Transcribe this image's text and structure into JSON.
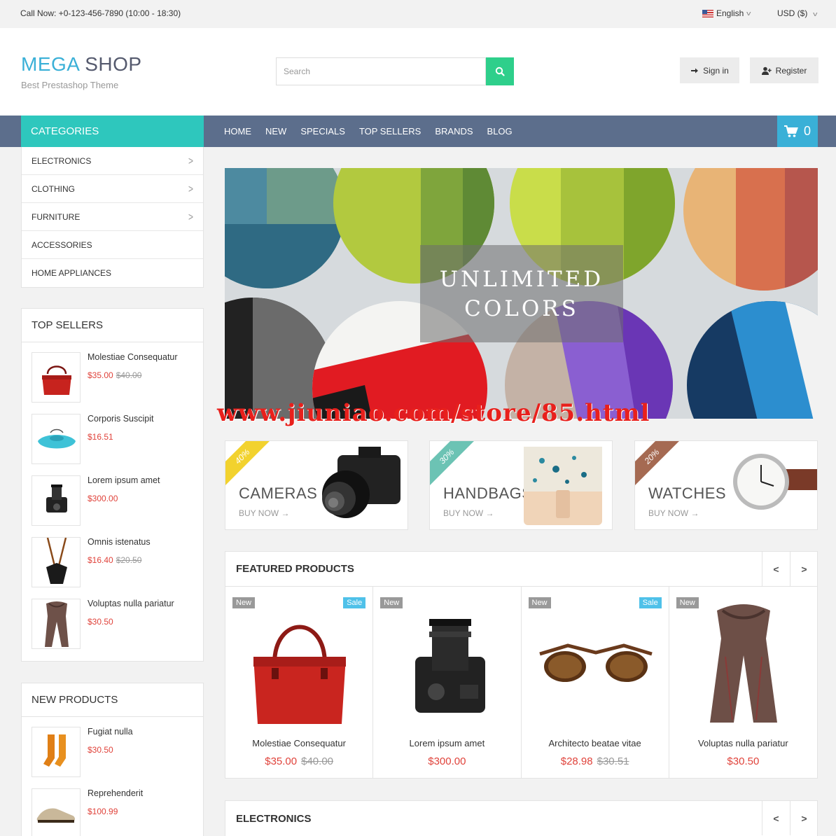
{
  "topbar": {
    "call": "Call Now: +0-123-456-7890 (10:00 - 18:30)",
    "language": "English",
    "currency": "USD ($)"
  },
  "header": {
    "logo_part1": "MEGA",
    "logo_part2": "SHOP",
    "tagline": "Best Prestashop Theme",
    "search_placeholder": "Search",
    "signin": "Sign in",
    "register": "Register"
  },
  "nav": {
    "categories_title": "CATEGORIES",
    "items": [
      "HOME",
      "NEW",
      "SPECIALS",
      "TOP SELLERS",
      "BRANDS",
      "BLOG"
    ],
    "cart_count": "0"
  },
  "categories": [
    {
      "label": "ELECTRONICS",
      "has_sub": true
    },
    {
      "label": "CLOTHING",
      "has_sub": true
    },
    {
      "label": "FURNITURE",
      "has_sub": true
    },
    {
      "label": "ACCESSORIES",
      "has_sub": false
    },
    {
      "label": "HOME APPLIANCES",
      "has_sub": false
    }
  ],
  "top_sellers": {
    "title": "TOP SELLERS",
    "items": [
      {
        "name": "Molestiae Consequatur",
        "price": "$35.00",
        "old_price": "$40.00",
        "icon": "handbag-icon"
      },
      {
        "name": "Corporis Suscipit",
        "price": "$16.51",
        "old_price": "",
        "icon": "clutch-icon"
      },
      {
        "name": "Lorem ipsum amet",
        "price": "$300.00",
        "old_price": "",
        "icon": "camera-icon"
      },
      {
        "name": "Omnis istenatus",
        "price": "$16.40",
        "old_price": "$20.50",
        "icon": "necklace-icon"
      },
      {
        "name": "Voluptas nulla pariatur",
        "price": "$30.50",
        "old_price": "",
        "icon": "scarf-icon"
      }
    ]
  },
  "new_products": {
    "title": "NEW PRODUCTS",
    "items": [
      {
        "name": "Fugiat nulla",
        "price": "$30.50",
        "icon": "socks-icon"
      },
      {
        "name": "Reprehenderit",
        "price": "$100.99",
        "icon": "shoe-icon"
      }
    ]
  },
  "banner": {
    "line1": "UNLIMITED",
    "line2": "COLORS"
  },
  "watermark": "www.jiuniao.com/store/85.html",
  "promos": [
    {
      "title": "CAMERAS",
      "buy": "BUY NOW",
      "badge": "40%",
      "badge_color": "#f2d22e"
    },
    {
      "title": "HANDBAGS",
      "buy": "BUY NOW",
      "badge": "30%",
      "badge_color": "#6cc3b4"
    },
    {
      "title": "WATCHES",
      "buy": "BUY NOW",
      "badge": "20%",
      "badge_color": "#a56a52"
    }
  ],
  "featured": {
    "title": "FEATURED PRODUCTS",
    "products": [
      {
        "name": "Molestiae Consequatur",
        "price": "$35.00",
        "old_price": "$40.00",
        "new": "New",
        "sale": "Sale"
      },
      {
        "name": "Lorem ipsum amet",
        "price": "$300.00",
        "old_price": "",
        "new": "New",
        "sale": ""
      },
      {
        "name": "Architecto beatae vitae",
        "price": "$28.98",
        "old_price": "$30.51",
        "new": "New",
        "sale": "Sale"
      },
      {
        "name": "Voluptas nulla pariatur",
        "price": "$30.50",
        "old_price": "",
        "new": "New",
        "sale": ""
      }
    ]
  },
  "electronics": {
    "title": "ELECTRONICS"
  },
  "colors": {
    "accent_teal": "#2ec7bd",
    "nav_bg": "#5c6e8c",
    "cart_blue": "#3ab0d7",
    "search_green": "#2ecf8b",
    "price_red": "#e0433b"
  }
}
